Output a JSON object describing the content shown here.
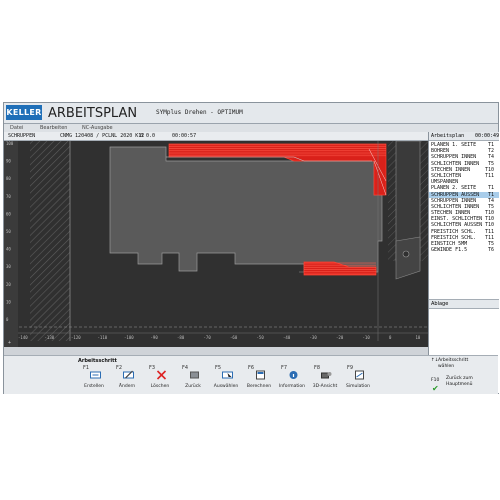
{
  "app": {
    "logo": "KELLER",
    "title": "ARBEITSPLAN",
    "machine": "SYMplus Drehen - OPTIMUM"
  },
  "tabs": [
    "Datei",
    "Bearbeiten",
    "NC-Ausgabe"
  ],
  "infobar": {
    "operation": "SCHRUPPEN",
    "tool": "CNMG 120408 / PCLNL 2020 K12",
    "coord": "0 0.0",
    "time": "00:00:57"
  },
  "axis": {
    "y_labels": [
      "100",
      "90",
      "80",
      "70",
      "60",
      "50",
      "40",
      "30",
      "20",
      "10",
      "0"
    ],
    "x_labels": [
      "-140",
      "-130",
      "-120",
      "-110",
      "-100",
      "-90",
      "-80",
      "-70",
      "-60",
      "-50",
      "-40",
      "-30",
      "-20",
      "-10",
      "0",
      "10"
    ]
  },
  "plan": {
    "header": "Arbeitsplan",
    "total_time": "00:00:49",
    "steps": [
      {
        "name": "PLANEN 1. SEITE",
        "tool": "T1",
        "selected": false
      },
      {
        "name": "BOHREN",
        "tool": "T2",
        "selected": false
      },
      {
        "name": "SCHRUPPEN INNEN",
        "tool": "T4",
        "selected": false
      },
      {
        "name": "SCHLICHTEN INNEN",
        "tool": "T5",
        "selected": false
      },
      {
        "name": "STECHEN INNEN",
        "tool": "T10",
        "selected": false
      },
      {
        "name": "SCHLICHTEN",
        "tool": "T11",
        "selected": false
      },
      {
        "name": "UMSPANNEN",
        "tool": "",
        "selected": false
      },
      {
        "name": "PLANEN 2. SEITE",
        "tool": "T1",
        "selected": false
      },
      {
        "name": "SCHRUPPEN AUSSEN",
        "tool": "T1",
        "selected": true
      },
      {
        "name": "SCHRUPPEN INNEN",
        "tool": "T4",
        "selected": false
      },
      {
        "name": "SCHLICHTEN INNEN",
        "tool": "T5",
        "selected": false
      },
      {
        "name": "STECHEN INNEN",
        "tool": "T10",
        "selected": false
      },
      {
        "name": "EINST. SCHLICHTEN",
        "tool": "T10",
        "selected": false
      },
      {
        "name": "SCHLICHTEN AUSSEN",
        "tool": "T10",
        "selected": false
      },
      {
        "name": "FREISTICH SCHL.",
        "tool": "T11",
        "selected": false
      },
      {
        "name": "FREISTICH SCHL.",
        "tool": "T11",
        "selected": false
      },
      {
        "name": "EINSTICH 5MM",
        "tool": "T5",
        "selected": false
      },
      {
        "name": "GEWINDE F1.5",
        "tool": "T6",
        "selected": false
      }
    ]
  },
  "ablage": "Ablage",
  "softkeys": {
    "title": "Arbeitsschritt",
    "keys": [
      {
        "fn": "F1",
        "label": "Erstellen",
        "icon": "create-icon"
      },
      {
        "fn": "F2",
        "label": "Ändern",
        "icon": "edit-icon"
      },
      {
        "fn": "F3",
        "label": "Löschen",
        "icon": "delete-icon"
      },
      {
        "fn": "F4",
        "label": "Zurück",
        "icon": "back-icon"
      },
      {
        "fn": "F5",
        "label": "Auswählen",
        "icon": "select-icon"
      },
      {
        "fn": "F6",
        "label": "Berechnen",
        "icon": "calculate-icon"
      },
      {
        "fn": "F7",
        "label": "Information",
        "icon": "info-icon"
      },
      {
        "fn": "F8",
        "label": "3D-Ansicht",
        "icon": "3d-view-icon"
      },
      {
        "fn": "F9",
        "label": "Simulation",
        "icon": "simulation-icon"
      }
    ],
    "right": {
      "select_label": "Arbeitsschritt wählen",
      "back_key": "F10",
      "back_label": "Zurück zum Hauptmenü"
    }
  },
  "colors": {
    "canvas_bg": "#303030",
    "part_fill": "#5a5a5a",
    "cut_red": "#e0201a",
    "selection": "#a9cdea",
    "logo_blue": "#1f6fb8"
  }
}
